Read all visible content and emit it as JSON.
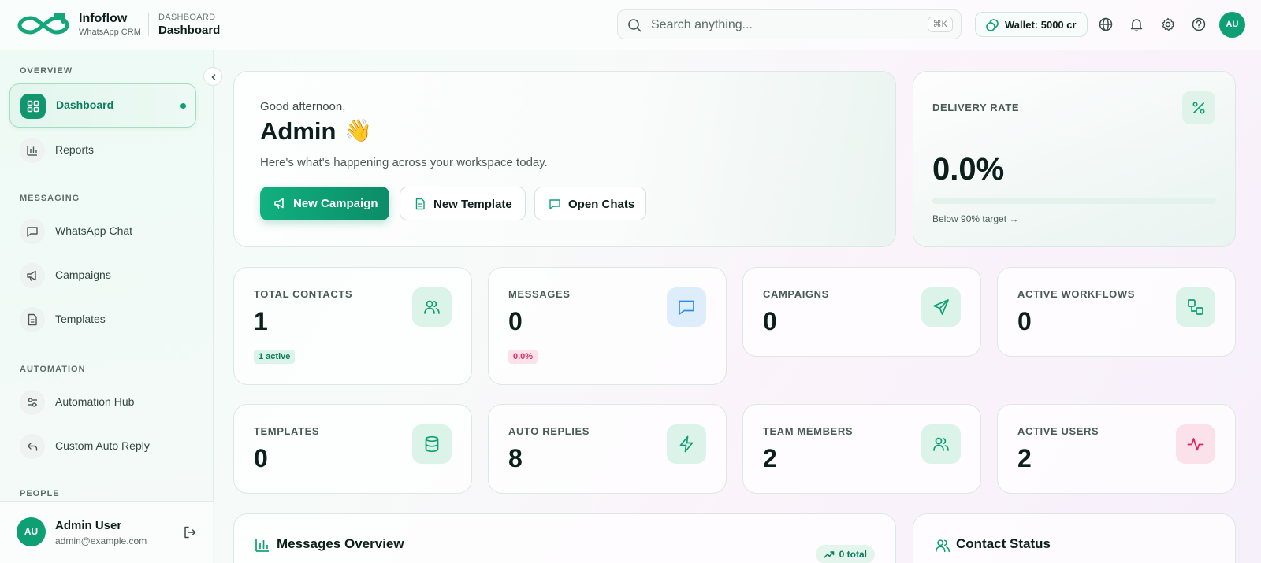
{
  "app": {
    "brand_name": "Infoflow",
    "brand_sub": "WhatsApp CRM",
    "breadcrumb_small": "DASHBOARD",
    "breadcrumb_title": "Dashboard"
  },
  "search": {
    "placeholder": "Search anything...",
    "value": "",
    "shortcut": "⌘K"
  },
  "wallet": {
    "label": "Wallet: 5000 cr"
  },
  "header_icons": [
    "globe-icon",
    "bell-icon",
    "gear-icon",
    "help-icon"
  ],
  "user": {
    "initials": "AU",
    "name": "Admin User",
    "email": "admin@example.com"
  },
  "sidebar": {
    "sections": [
      {
        "label": "OVERVIEW"
      },
      {
        "label": "MESSAGING"
      },
      {
        "label": "AUTOMATION"
      },
      {
        "label": "PEOPLE"
      }
    ],
    "items": [
      {
        "label": "Dashboard",
        "icon": "grid-icon",
        "active": true
      },
      {
        "label": "Reports",
        "icon": "bar-chart-icon"
      },
      {
        "label": "WhatsApp Chat",
        "icon": "chat-icon"
      },
      {
        "label": "Campaigns",
        "icon": "megaphone-icon"
      },
      {
        "label": "Templates",
        "icon": "document-icon"
      },
      {
        "label": "Automation Hub",
        "icon": "sliders-icon"
      },
      {
        "label": "Custom Auto Reply",
        "icon": "reply-icon"
      }
    ]
  },
  "hero": {
    "greeting": "Good afternoon,",
    "name": "Admin",
    "wave": "👋",
    "subtitle": "Here's what's happening across your workspace today.",
    "buttons": {
      "new_campaign": "New Campaign",
      "new_template": "New Template",
      "open_chats": "Open Chats"
    }
  },
  "delivery": {
    "label": "DELIVERY RATE",
    "value": "0.0%",
    "progress_fraction": 0.0,
    "note": "Below 90% target →"
  },
  "stats": [
    {
      "label": "TOTAL CONTACTS",
      "value": "1",
      "chip": "1 active",
      "icon": "users-icon"
    },
    {
      "label": "MESSAGES",
      "value": "0",
      "chip": "0.0%",
      "icon": "message-icon"
    },
    {
      "label": "CAMPAIGNS",
      "value": "0",
      "icon": "send-icon"
    },
    {
      "label": "ACTIVE WORKFLOWS",
      "value": "0",
      "icon": "workflow-icon"
    },
    {
      "label": "TEMPLATES",
      "value": "0",
      "icon": "database-icon"
    },
    {
      "label": "AUTO REPLIES",
      "value": "8",
      "icon": "bolt-icon"
    },
    {
      "label": "TEAM MEMBERS",
      "value": "2",
      "icon": "users-icon"
    },
    {
      "label": "ACTIVE USERS",
      "value": "2",
      "icon": "activity-icon"
    }
  ],
  "messages_overview": {
    "title": "Messages Overview",
    "total_badge": "0 total"
  },
  "contact_status": {
    "title": "Contact Status"
  },
  "colors": {
    "accent": "#0e9f74",
    "accent_dark": "#0c7d5c",
    "blue": "#2f8ce6",
    "pink": "#e0245e"
  }
}
